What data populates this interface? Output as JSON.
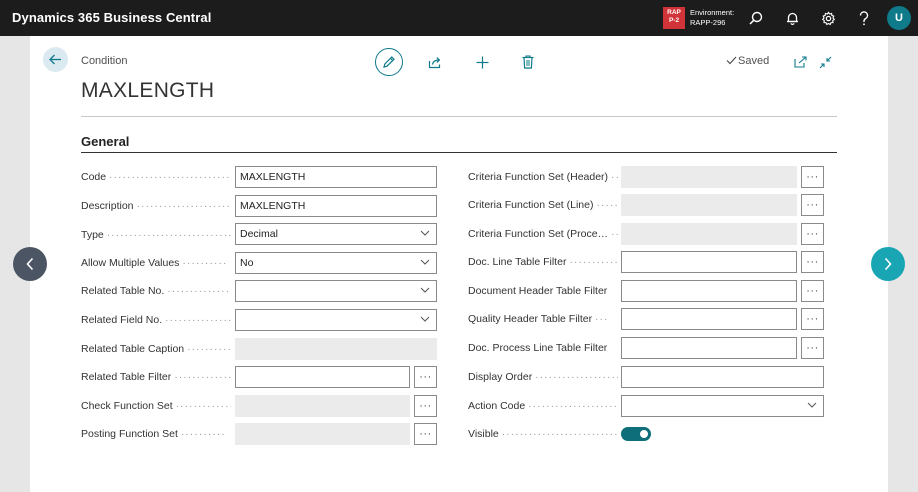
{
  "app": {
    "title": "Dynamics 365 Business Central"
  },
  "environment": {
    "badge_line1": "RAP",
    "badge_line2": "P-2",
    "label": "Environment:",
    "name": "RAPP-296"
  },
  "user": {
    "initial": "U"
  },
  "page": {
    "breadcrumb": "Condition",
    "title": "MAXLENGTH",
    "saved": "Saved"
  },
  "section": {
    "title": "General"
  },
  "left_fields": [
    {
      "label": "Code",
      "value": "MAXLENGTH",
      "kind": "text"
    },
    {
      "label": "Description",
      "value": "MAXLENGTH",
      "kind": "text"
    },
    {
      "label": "Type",
      "value": "Decimal",
      "kind": "select"
    },
    {
      "label": "Allow Multiple Values",
      "value": "No",
      "kind": "select"
    },
    {
      "label": "Related Table No.",
      "value": "",
      "kind": "select"
    },
    {
      "label": "Related Field No.",
      "value": "",
      "kind": "select"
    },
    {
      "label": "Related Table Caption",
      "value": "",
      "kind": "readonly"
    },
    {
      "label": "Related Table Filter",
      "value": "",
      "kind": "assist"
    },
    {
      "label": "Check Function Set",
      "value": "",
      "kind": "readonly-assist"
    },
    {
      "label": "Posting Function Set",
      "value": "",
      "kind": "readonly-assist"
    }
  ],
  "right_fields": [
    {
      "label": "Criteria Function Set (Header)",
      "value": "",
      "kind": "readonly-assist"
    },
    {
      "label": "Criteria Function Set (Line)",
      "value": "",
      "kind": "readonly-assist"
    },
    {
      "label": "Criteria Function Set (Proce…",
      "value": "",
      "kind": "readonly-assist"
    },
    {
      "label": "Doc. Line Table Filter",
      "value": "",
      "kind": "assist"
    },
    {
      "label": "Document Header Table Filter",
      "value": "",
      "kind": "assist"
    },
    {
      "label": "Quality Header Table Filter",
      "value": "",
      "kind": "assist"
    },
    {
      "label": "Doc. Process Line Table Filter",
      "value": "",
      "kind": "assist"
    },
    {
      "label": "Display Order",
      "value": "",
      "kind": "text"
    },
    {
      "label": "Action Code",
      "value": "",
      "kind": "select"
    },
    {
      "label": "Visible",
      "value": "On",
      "kind": "toggle"
    }
  ],
  "assist_glyph": "···",
  "colors": {
    "accent": "#0e7a8a",
    "topbar": "#1c1c1c",
    "env_badge": "#d13438",
    "next_nav": "#19a5b4"
  }
}
